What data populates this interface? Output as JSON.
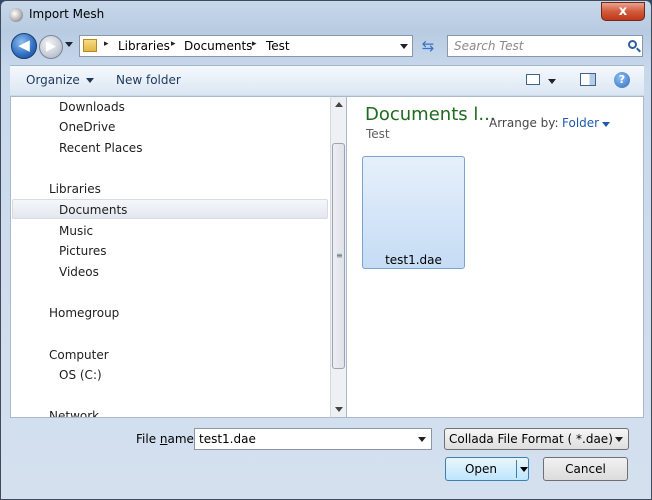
{
  "window": {
    "title": "Import Mesh",
    "close_label": "x"
  },
  "nav": {
    "back_glyph": "◀",
    "forward_glyph": "▶",
    "breadcrumbs": [
      "Libraries",
      "Documents",
      "Test"
    ],
    "crumb_separator": "▸",
    "refresh_glyph": "⇆",
    "search_placeholder": "Search Test"
  },
  "toolbar": {
    "organize": "Organize",
    "new_folder": "New folder",
    "help_glyph": "?"
  },
  "sidebar": {
    "items": [
      "Downloads",
      "OneDrive",
      "Recent Places",
      "Libraries",
      "Documents",
      "Music",
      "Pictures",
      "Videos",
      "Homegroup",
      "Computer",
      "OS (C:)",
      "Network"
    ],
    "selected": "Documents"
  },
  "content": {
    "library_title": "Documents l...",
    "library_subtitle": "Test",
    "arrange_label": "Arrange by:",
    "arrange_value": "Folder",
    "files": [
      {
        "name": "test1.dae"
      }
    ]
  },
  "footer": {
    "file_name_label_prefix": "File ",
    "file_name_label_accel": "n",
    "file_name_label_suffix": "ame:",
    "file_name_value": "test1.dae",
    "file_type": "Collada File Format ( *.dae)",
    "open_label": "Open",
    "cancel_label": "Cancel"
  },
  "colors": {
    "library_title": "#1e6a1e",
    "link_blue": "#1e5aa8",
    "selected_row": "#e3e8ef"
  }
}
